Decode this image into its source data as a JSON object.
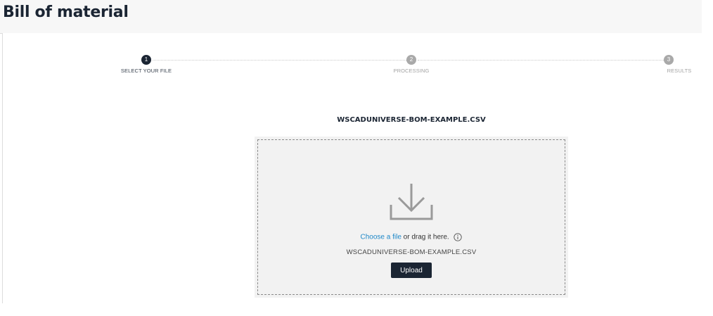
{
  "page": {
    "title": "Bill of material"
  },
  "stepper": {
    "steps": [
      {
        "number": "1",
        "label": "SELECT YOUR FILE",
        "state": "active"
      },
      {
        "number": "2",
        "label": "PROCESSING",
        "state": "pending"
      },
      {
        "number": "3",
        "label": "RESULTS",
        "state": "pending"
      }
    ]
  },
  "upload": {
    "heading": "WSCADUNIVERSE-BOM-EXAMPLE.CSV",
    "choose_link": "Choose a file",
    "drag_text": " or drag it here.",
    "selected_file": "WSCADUNIVERSE-BOM-EXAMPLE.CSV",
    "button_label": "Upload",
    "drop_icon": "download-icon",
    "info_icon": "info-icon"
  },
  "colors": {
    "dark": "#1b2533",
    "link": "#1e88c8",
    "dropzone_bg": "#f2f2f2"
  }
}
